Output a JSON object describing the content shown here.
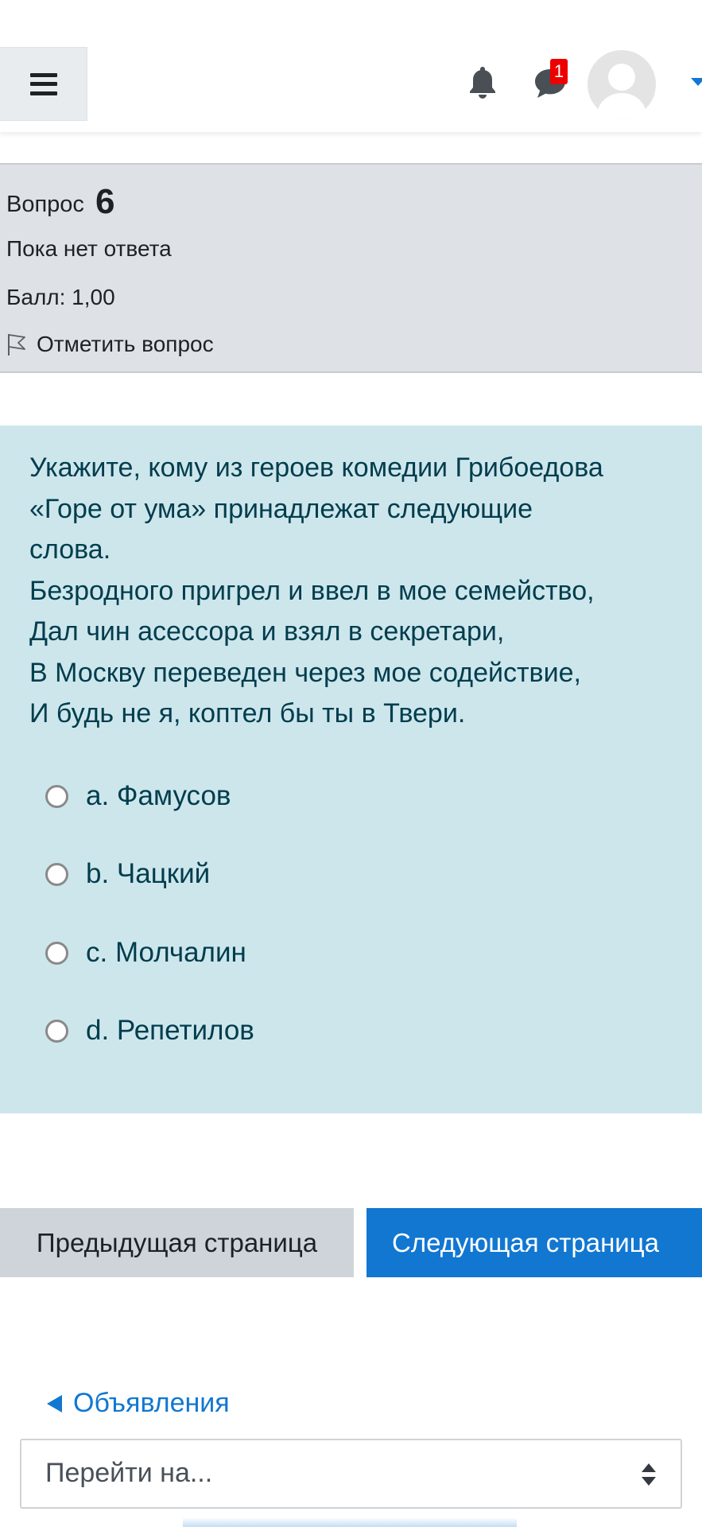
{
  "navbar": {
    "menu_icon": "hamburger-icon",
    "notification_icon": "bell-icon",
    "message_icon": "speech-bubble-icon",
    "message_count": "1",
    "avatar_icon": "user-avatar-icon"
  },
  "question_info": {
    "label": "Вопрос",
    "number": "6",
    "state": "Пока нет ответа",
    "grade": "Балл: 1,00",
    "flag_label": "Отметить вопрос"
  },
  "question": {
    "text_lines": [
      "Укажите, кому из героев комедии Грибоедова",
      "«Горе от ума» принадлежат следующие",
      "слова.",
      "Безродного пригрел и ввел в мое семейство,",
      "Дал чин асессора и взял в секретари,",
      "В Москву переведен через мое содействие,",
      "И будь не я, коптел бы ты в Твери."
    ],
    "options": [
      {
        "label": "a. Фамусов",
        "selected": false
      },
      {
        "label": "b. Чацкий",
        "selected": false
      },
      {
        "label": "c. Молчалин",
        "selected": false
      },
      {
        "label": "d. Репетилов",
        "selected": false
      }
    ]
  },
  "navigation": {
    "prev_page": "Предыдущая страница",
    "next_page": "Следующая страница",
    "prev_activity": "Объявления",
    "jump_placeholder": "Перейти на..."
  },
  "colors": {
    "primary": "#1177d1",
    "content_bg": "#cde6ec",
    "info_bg": "#dee2e6",
    "badge": "#ec0000"
  }
}
